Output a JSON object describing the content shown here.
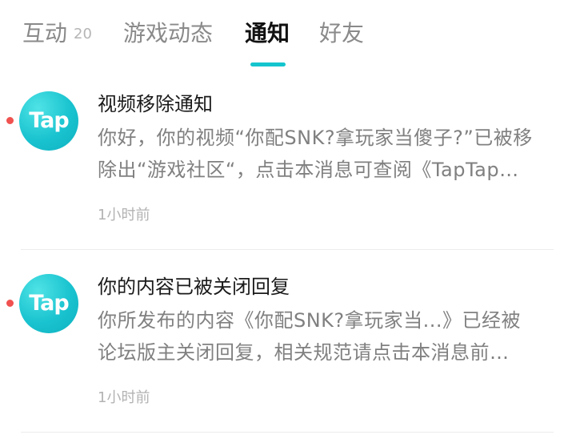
{
  "tabs": [
    {
      "label": "互动",
      "count": "20"
    },
    {
      "label": "游戏动态"
    },
    {
      "label": "通知"
    },
    {
      "label": "好友"
    }
  ],
  "active_tab": "通知",
  "accent_color": "#15c5ce",
  "unread_color": "#f0524f",
  "notifications": [
    {
      "avatar_text": "Tap",
      "title": "视频移除通知",
      "body_lines": [
        "你好，你的视频“你配SNK?拿玩家当傻子?”已被移",
        "除出“游戏社区“，点击本消息可查阅《TapTap…"
      ],
      "time": "1小时前",
      "unread": true
    },
    {
      "avatar_text": "Tap",
      "title": "你的内容已被关闭回复",
      "body_lines": [
        "你所发布的内容《你配SNK?拿玩家当...》已经被",
        "论坛版主关闭回复，相关规范请点击本消息前…"
      ],
      "time": "1小时前",
      "unread": true
    }
  ]
}
